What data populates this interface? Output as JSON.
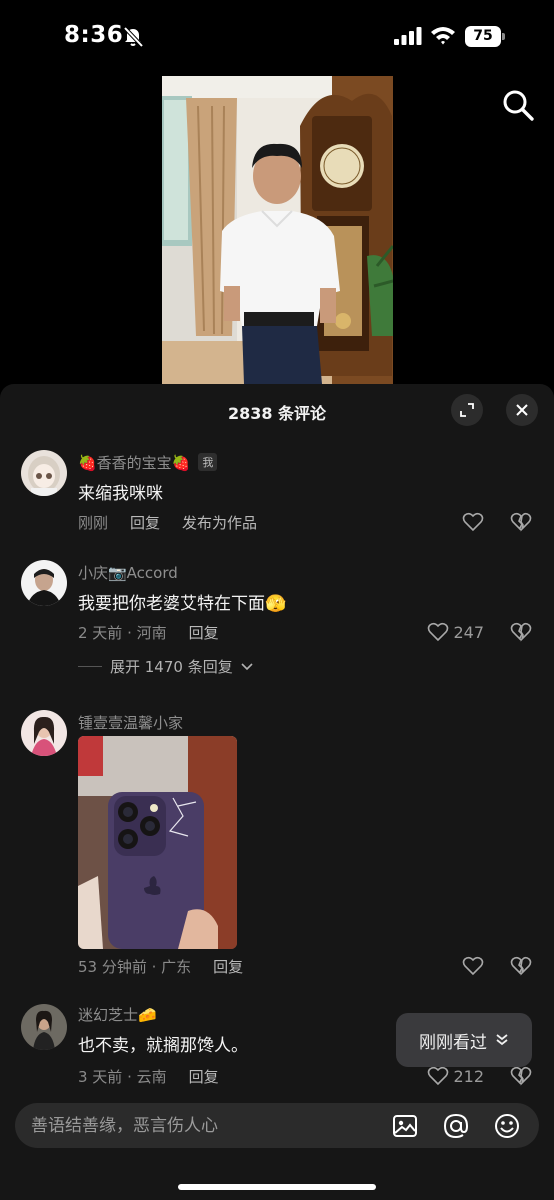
{
  "status": {
    "time": "8:36",
    "battery": "75"
  },
  "sheet": {
    "title": "2838 条评论"
  },
  "comments": [
    {
      "username": "🍓香香的宝宝🍓",
      "badge": "我",
      "text": "来缩我咪咪",
      "time": "刚刚",
      "reply": "回复",
      "publish": "发布为作品"
    },
    {
      "username": "小庆📷Accord",
      "text": "我要把你老婆艾特在下面🫣",
      "time": "2 天前 · 河南",
      "reply": "回复",
      "likes": "247",
      "expand": "展开 1470 条回复"
    },
    {
      "username": "锺壹壹温馨小家",
      "time": "53 分钟前 · 广东",
      "reply": "回复"
    },
    {
      "username": "迷幻芝士🧀",
      "text": "也不卖，就搁那馋人。",
      "time": "3 天前 · 云南",
      "reply": "回复",
      "likes": "212"
    }
  ],
  "seen_button": "刚刚看过",
  "input": {
    "placeholder": "善语结善缘，恶言伤人心"
  }
}
